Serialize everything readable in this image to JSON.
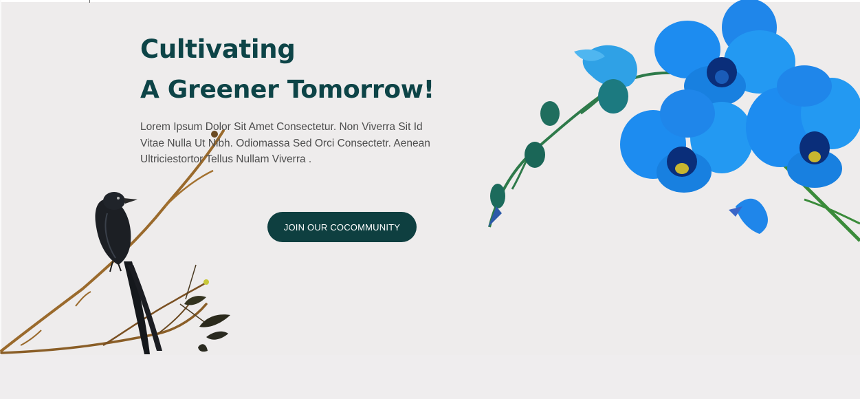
{
  "hero": {
    "title_line1": "Cultivating",
    "title_line2": "A Greener Tomorrow!",
    "description": "Lorem Ipsum Dolor Sit Amet Consectetur. Non Viverra Sit Id Vitae Nulla Ut Nibh. Odiomassa Sed Orci Consectetr. Aenean Ultriciestortor Tellus Nullam Viverra .",
    "cta_label": "JOIN OUR COCOMMUNITY"
  },
  "colors": {
    "background": "#eeecec",
    "heading": "#0d4447",
    "button_bg": "#0e3f40",
    "button_text": "#ffffff",
    "orchid": "#1e8ff0"
  },
  "images": {
    "bird_on_branch": "bird-branch-icon",
    "blue_orchid": "orchid-flower-icon"
  }
}
